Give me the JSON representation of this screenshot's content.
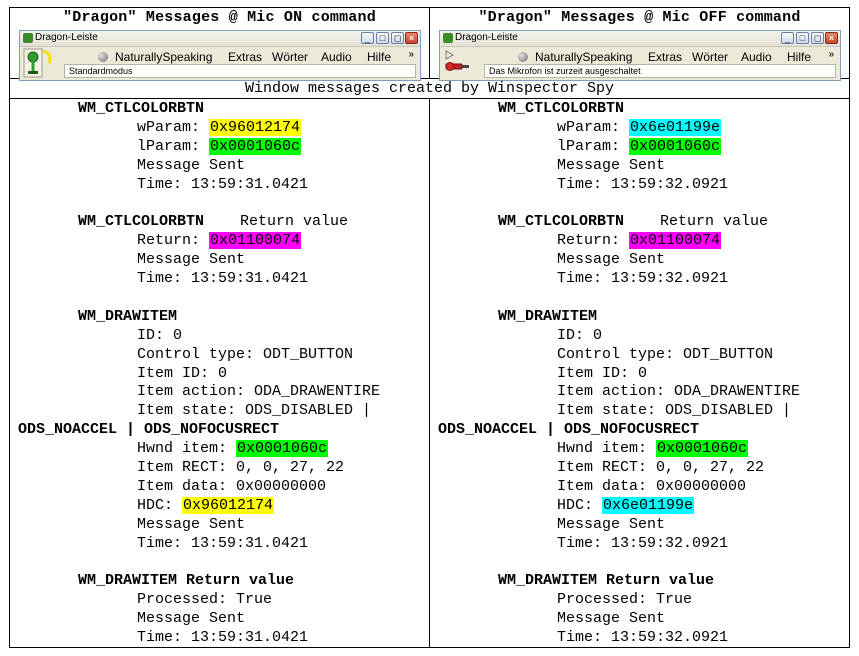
{
  "colors": {
    "yellow": "#ffff00",
    "green": "#00ff00",
    "magenta": "#ff00ff",
    "cyan": "#00ffff"
  },
  "headers": {
    "left": "\"Dragon\" Messages @ Mic ON command",
    "right": "\"Dragon\" Messages @ Mic OFF command"
  },
  "toolbar": {
    "title": "Dragon-Leiste",
    "menus": [
      "NaturallySpeaking",
      "Extras",
      "Wörter",
      "Audio",
      "Hilfe"
    ],
    "more": "»",
    "status_left": "Standardmodus",
    "status_right": "Das Mikrofon ist zurzeit ausgeschaltet",
    "mic_left": "mic-on-icon",
    "mic_right": "mic-off-icon"
  },
  "caption": "Window messages created by Winspector Spy",
  "left": {
    "msg1_name": "WM_CTLCOLORBTN",
    "wparam_label": "wParam: ",
    "wparam": "0x96012174",
    "lparam_label": "lParam: ",
    "lparam": "0x0001060c",
    "sent1": "Message Sent",
    "time1": "Time: 13:59:31.0421",
    "msg2_name": "WM_CTLCOLORBTN",
    "msg2_suffix": "    Return value",
    "return_label": "Return: ",
    "return_val": "0x01100074",
    "sent2": "Message Sent",
    "time2": "Time: 13:59:31.0421",
    "msg3_name": "WM_DRAWITEM",
    "id": "ID: 0",
    "control_type": "Control type: ODT_BUTTON",
    "item_id": "Item ID: 0",
    "item_action": "Item action: ODA_DRAWENTIRE",
    "item_state": "Item state: ODS_DISABLED |",
    "item_state_cont": "ODS_NOACCEL | ODS_NOFOCUSRECT",
    "hwnd_label": "Hwnd item: ",
    "hwnd": "0x0001060c",
    "item_rect": "Item RECT: 0, 0, 27, 22",
    "item_data": "Item data: 0x00000000",
    "hdc_label": "HDC: ",
    "hdc": "0x96012174",
    "sent3": "Message Sent",
    "time3": "Time: 13:59:31.0421",
    "msg4_name": "WM_DRAWITEM Return value",
    "processed": "Processed: True",
    "sent4": "Message Sent",
    "time4": "Time: 13:59:31.0421"
  },
  "right": {
    "msg1_name": "WM_CTLCOLORBTN",
    "wparam_label": "wParam: ",
    "wparam": "0x6e01199e",
    "lparam_label": "lParam: ",
    "lparam": "0x0001060c",
    "sent1": "Message Sent",
    "time1": "Time: 13:59:32.0921",
    "msg2_name": "WM_CTLCOLORBTN",
    "msg2_suffix": "    Return value",
    "return_label": "Return: ",
    "return_val": "0x01100074",
    "sent2": "Message Sent",
    "time2": "Time: 13:59:32.0921",
    "msg3_name": "WM_DRAWITEM",
    "id": "ID: 0",
    "control_type": "Control type: ODT_BUTTON",
    "item_id": "Item ID: 0",
    "item_action": "Item action: ODA_DRAWENTIRE",
    "item_state": "Item state: ODS_DISABLED |",
    "item_state_cont": "ODS_NOACCEL | ODS_NOFOCUSRECT",
    "hwnd_label": "Hwnd item: ",
    "hwnd": "0x0001060c",
    "item_rect": "Item RECT: 0, 0, 27, 22",
    "item_data": "Item data: 0x00000000",
    "hdc_label": "HDC: ",
    "hdc": "0x6e01199e",
    "sent3": "Message Sent",
    "time3": "Time: 13:59:32.0921",
    "msg4_name": "WM_DRAWITEM Return value",
    "processed": "Processed: True",
    "sent4": "Message Sent",
    "time4": "Time: 13:59:32.0921"
  }
}
